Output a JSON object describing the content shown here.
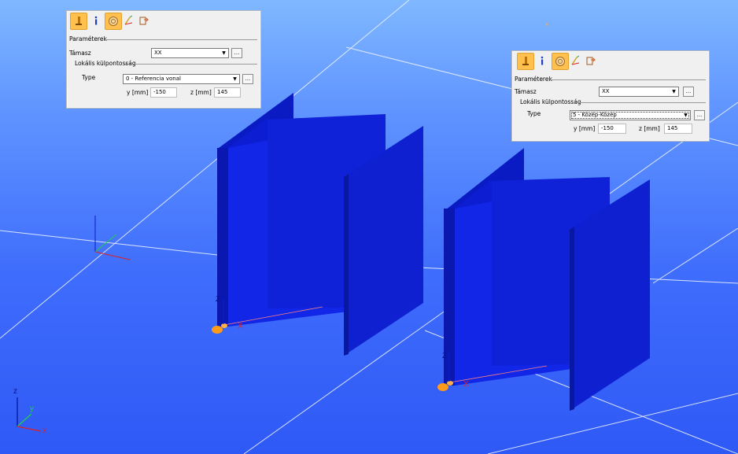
{
  "panel_left": {
    "section_title": "Paraméterek",
    "support_label": "Támasz",
    "support_value": "XX",
    "eccentricity_title": "Lokális külpontosság",
    "type_label": "Type",
    "type_value": "0 - Referencia vonal",
    "y_label": "y [mm]",
    "y_value": "-150",
    "z_label": "z [mm]",
    "z_value": "145",
    "ellipsis": "..."
  },
  "panel_right": {
    "section_title": "Paraméterek",
    "support_label": "Támasz",
    "support_value": "XX",
    "eccentricity_title": "Lokális külpontosság",
    "type_label": "Type",
    "type_value": "5 - Közép-Közép",
    "y_label": "y [mm]",
    "y_value": "-150",
    "z_label": "z [mm]",
    "z_value": "145",
    "ellipsis": "..."
  },
  "toolbar_icons": [
    "support-icon",
    "info-icon",
    "snap-icon",
    "axis-icon",
    "export-icon"
  ],
  "axes": {
    "global": {
      "x": "x",
      "y": "y",
      "z": "z"
    },
    "local_left": {
      "x": "X",
      "z": "Z"
    },
    "local_right": {
      "x": "X",
      "z": "Z"
    }
  },
  "colors": {
    "beam": "#0f20d8",
    "beam_dark": "#081aa8",
    "toolbar_active": "#ffc04d",
    "support_node": "#ff9a1a"
  }
}
